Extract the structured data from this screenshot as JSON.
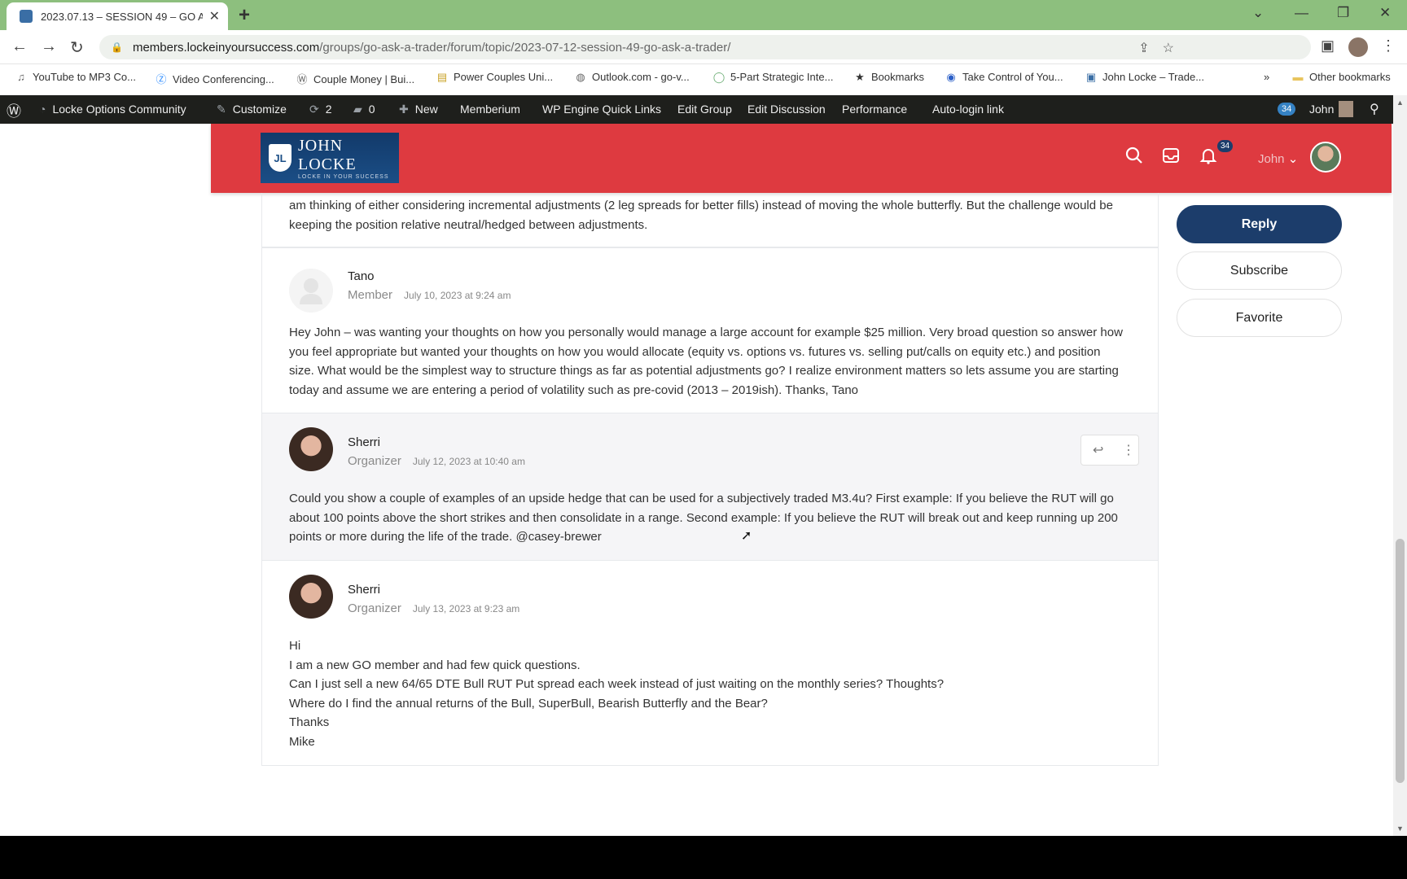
{
  "browser": {
    "tab_title": "2023.07.13 – SESSION 49 – GO A",
    "url_host": "members.lockeinyoursuccess.com",
    "url_path": "/groups/go-ask-a-trader/forum/topic/2023-07-12-session-49-go-ask-a-trader/"
  },
  "bookmarks": [
    {
      "label": "YouTube to MP3 Co...",
      "icon": "music-note-icon"
    },
    {
      "label": "Video Conferencing...",
      "icon": "zoom-icon"
    },
    {
      "label": "Couple Money | Bui...",
      "icon": "wordpress-icon"
    },
    {
      "label": "Power Couples Uni...",
      "icon": "page-icon"
    },
    {
      "label": "Outlook.com - go-v...",
      "icon": "globe-icon"
    },
    {
      "label": "5-Part Strategic Inte...",
      "icon": "circle-icon"
    },
    {
      "label": "Bookmarks",
      "icon": "star-icon"
    },
    {
      "label": "Take Control of You...",
      "icon": "target-icon"
    },
    {
      "label": "John Locke – Trade...",
      "icon": "lock-icon"
    }
  ],
  "bookmarks_more": "»",
  "other_bookmarks": "Other bookmarks",
  "adminbar": {
    "site": "Locke Options Community",
    "customize": "Customize",
    "updates": "2",
    "comments": "0",
    "new": "New",
    "memberium": "Memberium",
    "wpengine": "WP Engine Quick Links",
    "edit_group": "Edit Group",
    "edit_discussion": "Edit Discussion",
    "performance": "Performance",
    "autologin": "Auto-login link",
    "badge": "34",
    "user": "John"
  },
  "header": {
    "logo_title": "JOHN LOCKE",
    "logo_tagline": "LOCKE IN YOUR SUCCESS",
    "notifications": "34",
    "user": "John"
  },
  "sidebar": {
    "reply": "Reply",
    "subscribe": "Subscribe",
    "favorite": "Favorite"
  },
  "posts": [
    {
      "name": "",
      "lines": [
        "am thinking of either considering incremental adjustments (2 leg spreads for better fills) instead of moving the whole butterfly. But the challenge would be",
        "keeping the position relative neutral/hedged between adjustments."
      ]
    },
    {
      "name": "Tano",
      "role": "Member",
      "date": "July 10, 2023 at 9:24 am",
      "lines": [
        "Hey John – was wanting your thoughts on how you personally would manage a large account for example $25 million. Very broad question so answer how",
        "you feel appropriate but wanted your thoughts on how you would allocate (equity vs. options vs. futures vs. selling put/calls on equity etc.) and position",
        "size. What would be the simplest way to structure things as far as potential adjustments go? I realize environment matters so lets assume you are starting",
        "today and assume we are entering a period of volatility such as pre-covid (2013 – 2019ish). Thanks, Tano"
      ]
    },
    {
      "name": "Sherri",
      "role": "Organizer",
      "date": "July 12, 2023 at 10:40 am",
      "lines": [
        "Could you show a couple of examples of an upside hedge that can be used for a subjectively traded M3.4u? First example: If you believe the RUT will go",
        "about 100 points above the short strikes and then consolidate in a range. Second example: If you believe the RUT will break out and keep running up 200",
        "points or more during the life of the trade. @casey-brewer"
      ]
    },
    {
      "name": "Sherri",
      "role": "Organizer",
      "date": "July 13, 2023 at 9:23 am",
      "lines": [
        "Hi",
        "I am a new GO member and had few quick questions.",
        "Can I just sell a new 64/65 DTE Bull RUT Put spread each week instead of just waiting on the monthly series? Thoughts?",
        "Where do I find the annual returns of the Bull, SuperBull, Bearish Butterfly and the Bear?",
        "Thanks",
        "Mike"
      ]
    }
  ]
}
